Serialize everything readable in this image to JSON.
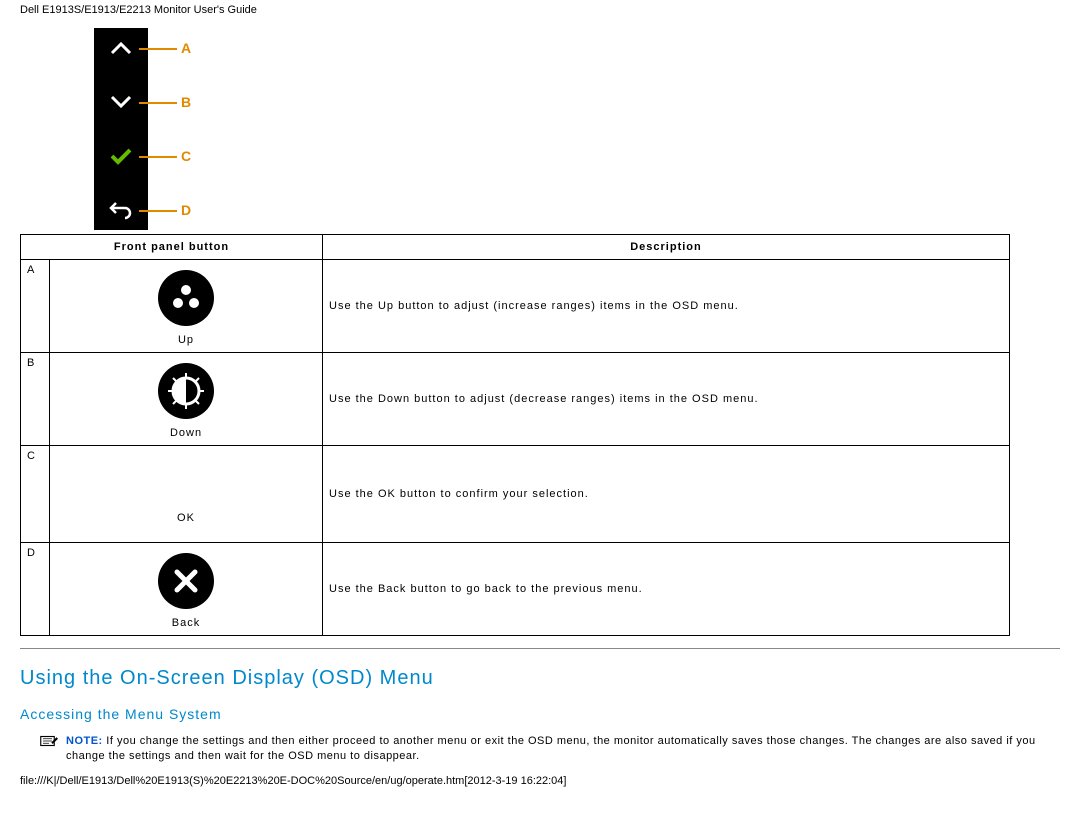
{
  "header": {
    "title": "Dell E1913S/E1913/E2213 Monitor User's Guide"
  },
  "strip": {
    "labels": [
      "A",
      "B",
      "C",
      "D"
    ]
  },
  "table": {
    "headers": {
      "button": "Front panel button",
      "desc": "Description"
    },
    "rows": [
      {
        "letter": "A",
        "caption": "Up",
        "desc": "Use the Up button to adjust (increase ranges) items in the OSD menu."
      },
      {
        "letter": "B",
        "caption": "Down",
        "desc": "Use the Down button to adjust (decrease ranges) items in the OSD menu."
      },
      {
        "letter": "C",
        "caption": "OK",
        "desc": "Use the OK button to confirm your selection."
      },
      {
        "letter": "D",
        "caption": "Back",
        "desc": "Use the Back button to go back to the previous menu."
      }
    ]
  },
  "section": {
    "heading": "Using the On-Screen Display (OSD) Menu",
    "subheading": "Accessing the Menu System"
  },
  "note": {
    "label": "NOTE:",
    "text": " If you change the settings and then either proceed to another menu or exit the OSD menu, the monitor automatically saves those changes. The changes are also saved if you change the settings and then wait for the OSD menu to disappear."
  },
  "footer": {
    "path": "file:///K|/Dell/E1913/Dell%20E1913(S)%20E2213%20E-DOC%20Source/en/ug/operate.htm[2012-3-19 16:22:04]"
  }
}
